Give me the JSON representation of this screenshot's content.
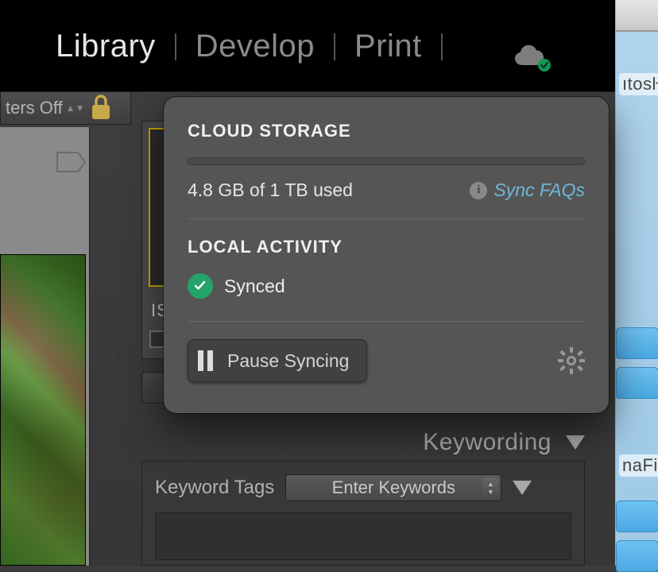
{
  "modules": {
    "library": "Library",
    "develop": "Develop",
    "print_": "Print"
  },
  "filters": {
    "label": "ters Off"
  },
  "cell": {
    "iso_label": "IS"
  },
  "popover": {
    "cloud_heading": "CLOUD STORAGE",
    "usage_text": "4.8 GB of 1 TB used",
    "faqs_label": "Sync FAQs",
    "local_heading": "LOCAL ACTIVITY",
    "status_text": "Synced",
    "pause_label": "Pause Syncing"
  },
  "keywording": {
    "panel_title": "Keywording",
    "tags_label": "Keyword Tags",
    "select_value": "Enter Keywords"
  },
  "desktop": {
    "label1": "ıtosŀ",
    "label2": "naFi"
  },
  "colors": {
    "accent_green": "#23a36a",
    "accent_link": "#6fb6d9",
    "gold": "#c9a800"
  }
}
